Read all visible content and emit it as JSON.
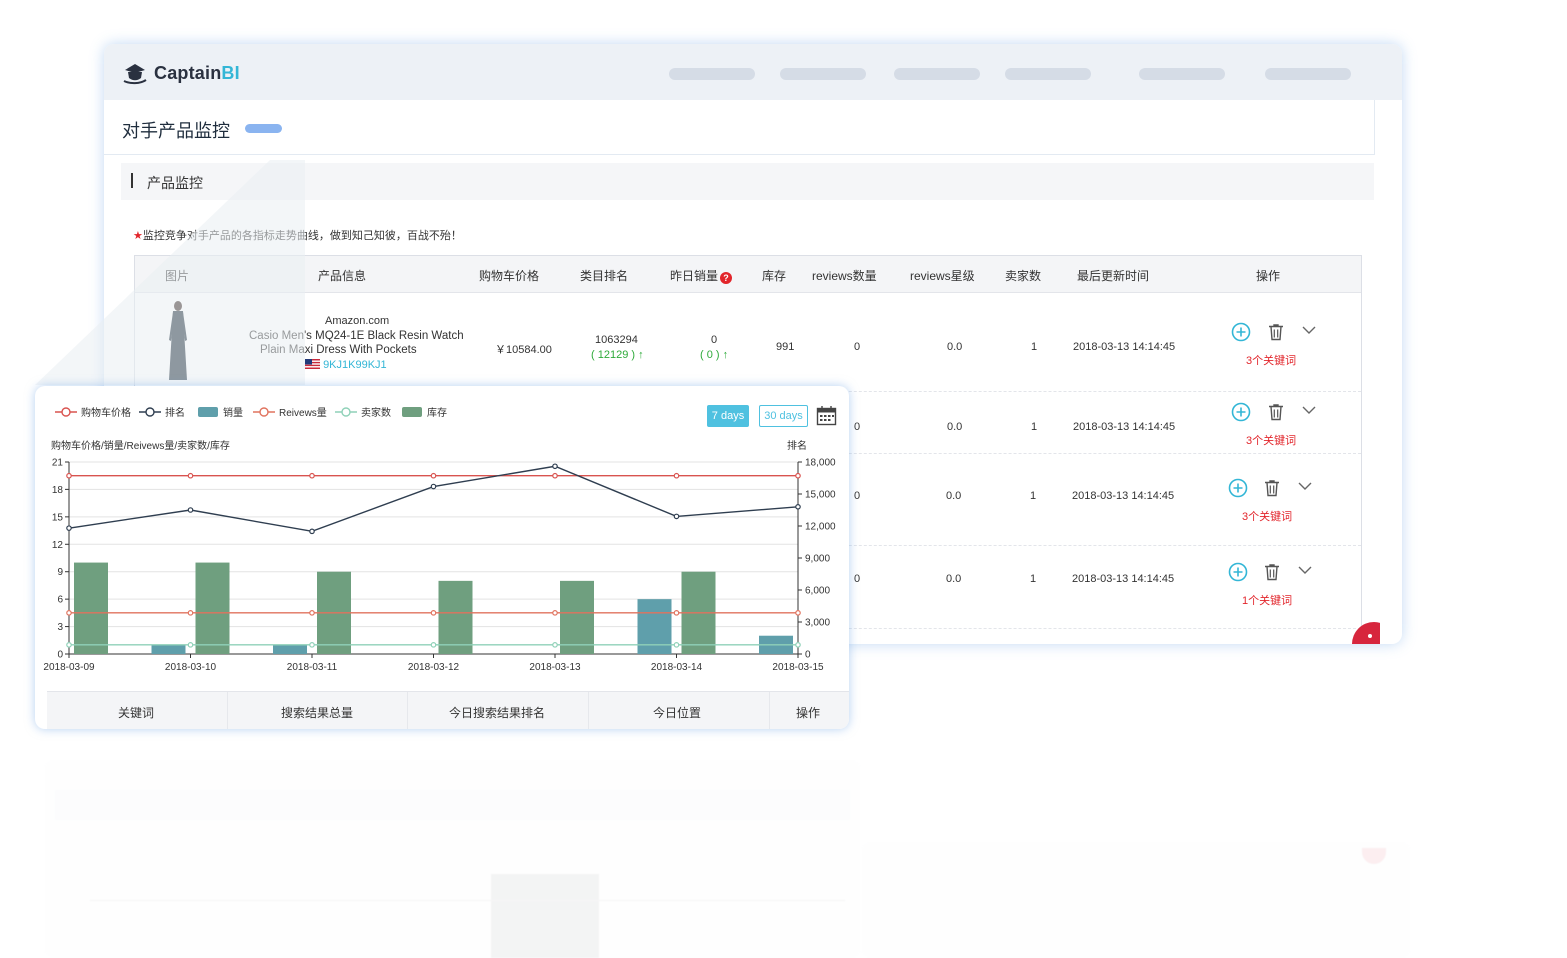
{
  "app": {
    "logo_main": "Captain",
    "logo_accent": "BI"
  },
  "page": {
    "title": "对手产品监控",
    "section_title": "产品监控",
    "notice_star": "★",
    "notice": "监控竞争对手产品的各指标走势曲线，做到知己知彼，百战不殆！"
  },
  "table": {
    "headers": {
      "image": "图片",
      "info": "产品信息",
      "cart_price": "购物车价格",
      "rank": "类目排名",
      "yesterday_sales": "昨日销量",
      "help": "?",
      "stock": "库存",
      "reviews_count": "reviews数量",
      "reviews_stars": "reviews星级",
      "sellers": "卖家数",
      "updated": "最后更新时间",
      "actions": "操作"
    },
    "first_row": {
      "store": "Amazon.com",
      "title_line1": "Casio Men's MQ24-1E Black Resin Watch",
      "title_line2": "Plain Maxi Dress With Pockets",
      "asin": "9KJ1K99KJ1",
      "price": "￥10584.00",
      "rank": "1063294",
      "rank_change": "( 12129 ) ↑",
      "sales": "0",
      "sales_change": "( 0 ) ↑",
      "stock": "991",
      "reviews_count": "0",
      "reviews_stars": "0.0",
      "sellers": "1",
      "updated": "2018-03-13 14:14:45",
      "keywords": "3个关键词"
    },
    "rows": [
      {
        "reviews_count": "0",
        "reviews_stars": "0.0",
        "sellers": "1",
        "updated": "2018-03-13 14:14:45",
        "keywords": "3个关键词"
      },
      {
        "reviews_count": "0",
        "reviews_stars": "0.0",
        "sellers": "1",
        "updated": "2018-03-13 14:14:45",
        "keywords": "3个关键词"
      },
      {
        "reviews_count": "0",
        "reviews_stars": "0.0",
        "sellers": "1",
        "updated": "2018-03-13 14:14:45",
        "keywords": "1个关键词"
      }
    ]
  },
  "chart_card": {
    "legend": [
      {
        "label": "购物车价格",
        "kind": "line",
        "color": "#d9534f"
      },
      {
        "label": "排名",
        "kind": "line",
        "color": "#2f3e50"
      },
      {
        "label": "销量",
        "kind": "bar",
        "color": "#5f9fab"
      },
      {
        "label": "Reivews量",
        "kind": "line",
        "color": "#e0735e"
      },
      {
        "label": "卖家数",
        "kind": "line",
        "color": "#8fd1b8"
      },
      {
        "label": "库存",
        "kind": "bar",
        "color": "#6f9f7f"
      }
    ],
    "btn_7days": "7 days",
    "btn_30days": "30 days",
    "left_axis_name": "购物车价格/销量/Reivews量/卖家数/库存",
    "right_axis_name": "排名",
    "keyword_headers": [
      "关键词",
      "搜索结果总量",
      "今日搜索结果排名",
      "今日位置",
      "操作"
    ]
  },
  "chart_data": {
    "type": "bar",
    "categories": [
      "2018-03-09",
      "2018-03-10",
      "2018-03-11",
      "2018-03-12",
      "2018-03-13",
      "2018-03-14",
      "2018-03-15"
    ],
    "left_axis": {
      "min": 0,
      "max": 21,
      "ticks": [
        0,
        3,
        6,
        9,
        12,
        15,
        18,
        21
      ]
    },
    "right_axis": {
      "min": 0,
      "max": 18000,
      "ticks": [
        "0",
        "3,000",
        "6,000",
        "9,000",
        "12,000",
        "15,000",
        "18,000"
      ]
    },
    "series": [
      {
        "name": "购物车价格",
        "type": "line",
        "axis": "left",
        "color": "#d9534f",
        "values": [
          19.5,
          19.5,
          19.5,
          19.5,
          19.5,
          19.5,
          19.5
        ]
      },
      {
        "name": "排名",
        "type": "line",
        "axis": "right",
        "color": "#2f3e50",
        "values": [
          11800,
          13500,
          11500,
          15700,
          17600,
          12900,
          13800
        ]
      },
      {
        "name": "销量",
        "type": "bar",
        "axis": "left",
        "color": "#5f9fab",
        "values": [
          0,
          1,
          1,
          0,
          0,
          6,
          2
        ]
      },
      {
        "name": "Reivews量",
        "type": "line",
        "axis": "left",
        "color": "#e0735e",
        "values": [
          4.5,
          4.5,
          4.5,
          4.5,
          4.5,
          4.5,
          4.5
        ]
      },
      {
        "name": "卖家数",
        "type": "line",
        "axis": "left",
        "color": "#8fd1b8",
        "values": [
          1,
          1,
          1,
          1,
          1,
          1,
          1
        ]
      },
      {
        "name": "库存",
        "type": "bar",
        "axis": "left",
        "color": "#6f9f7f",
        "values": [
          10,
          10,
          9,
          8,
          8,
          9,
          0
        ]
      }
    ],
    "grid": true,
    "legend_position": "top-left"
  }
}
